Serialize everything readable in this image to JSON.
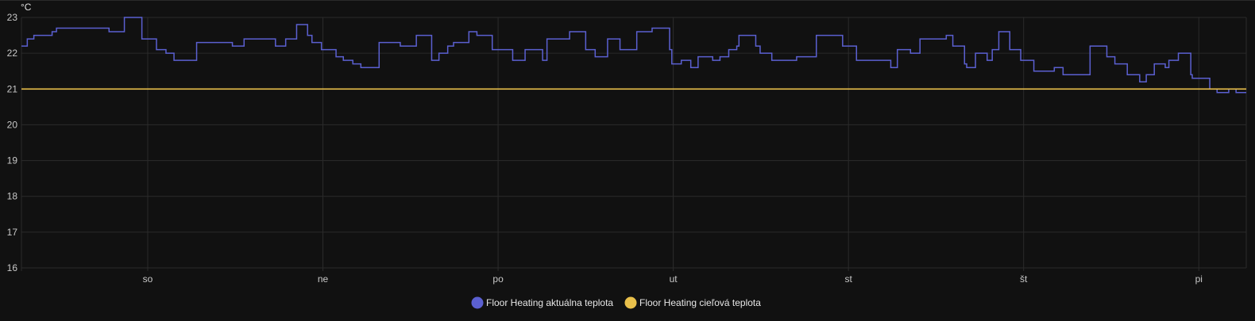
{
  "chart_data": {
    "type": "line",
    "step": true,
    "ylabel": "°C",
    "xlabel": "",
    "x_unit": "hours relative to start of 'so'",
    "xlim": [
      -17.3,
      150.5
    ],
    "ylim": [
      16,
      23
    ],
    "yticks": [
      16,
      17,
      18,
      19,
      20,
      21,
      22,
      23
    ],
    "xticks": [
      {
        "x": 0,
        "label": "so"
      },
      {
        "x": 24,
        "label": "ne"
      },
      {
        "x": 48,
        "label": "po"
      },
      {
        "x": 72,
        "label": "ut"
      },
      {
        "x": 96,
        "label": "st"
      },
      {
        "x": 120,
        "label": "št"
      },
      {
        "x": 144,
        "label": "pi"
      }
    ],
    "grid": true,
    "legend_position": "bottom-center",
    "series": [
      {
        "name": "Floor Heating aktuálna teplota",
        "color": "#5b60d1",
        "points": [
          [
            -17.3,
            22.2
          ],
          [
            -16.5,
            22.4
          ],
          [
            -15.6,
            22.5
          ],
          [
            -13.1,
            22.6
          ],
          [
            -12.5,
            22.7
          ],
          [
            -5.3,
            22.6
          ],
          [
            -3.2,
            23.0
          ],
          [
            -0.8,
            22.4
          ],
          [
            1.2,
            22.1
          ],
          [
            2.5,
            22.0
          ],
          [
            3.6,
            21.8
          ],
          [
            6.7,
            22.3
          ],
          [
            11.6,
            22.2
          ],
          [
            13.2,
            22.4
          ],
          [
            17.5,
            22.2
          ],
          [
            18.9,
            22.4
          ],
          [
            20.4,
            22.8
          ],
          [
            21.9,
            22.5
          ],
          [
            22.5,
            22.3
          ],
          [
            23.8,
            22.1
          ],
          [
            25.8,
            21.9
          ],
          [
            26.8,
            21.8
          ],
          [
            28.1,
            21.7
          ],
          [
            29.2,
            21.6
          ],
          [
            31.7,
            22.3
          ],
          [
            34.6,
            22.2
          ],
          [
            36.8,
            22.5
          ],
          [
            38.9,
            21.8
          ],
          [
            39.9,
            22.0
          ],
          [
            41.1,
            22.2
          ],
          [
            41.9,
            22.3
          ],
          [
            44.0,
            22.6
          ],
          [
            45.1,
            22.5
          ],
          [
            47.2,
            22.1
          ],
          [
            50.0,
            21.8
          ],
          [
            51.7,
            22.1
          ],
          [
            54.1,
            21.8
          ],
          [
            54.7,
            22.4
          ],
          [
            57.8,
            22.6
          ],
          [
            60.0,
            22.1
          ],
          [
            61.3,
            21.9
          ],
          [
            63.0,
            22.4
          ],
          [
            64.7,
            22.1
          ],
          [
            67.0,
            22.6
          ],
          [
            69.1,
            22.7
          ],
          [
            71.5,
            22.1
          ],
          [
            71.8,
            21.7
          ],
          [
            73.1,
            21.8
          ],
          [
            74.4,
            21.6
          ],
          [
            75.4,
            21.9
          ],
          [
            77.4,
            21.8
          ],
          [
            78.4,
            21.9
          ],
          [
            79.6,
            22.1
          ],
          [
            80.7,
            22.2
          ],
          [
            81.0,
            22.5
          ],
          [
            83.3,
            22.2
          ],
          [
            83.9,
            22.0
          ],
          [
            85.5,
            21.8
          ],
          [
            88.9,
            21.9
          ],
          [
            91.6,
            22.5
          ],
          [
            95.2,
            22.2
          ],
          [
            97.1,
            21.8
          ],
          [
            101.8,
            21.6
          ],
          [
            102.7,
            22.1
          ],
          [
            104.5,
            22.0
          ],
          [
            105.8,
            22.4
          ],
          [
            109.4,
            22.5
          ],
          [
            110.3,
            22.2
          ],
          [
            111.9,
            21.7
          ],
          [
            112.2,
            21.6
          ],
          [
            113.4,
            22.0
          ],
          [
            115.0,
            21.8
          ],
          [
            115.7,
            22.1
          ],
          [
            116.6,
            22.6
          ],
          [
            118.1,
            22.1
          ],
          [
            119.6,
            21.8
          ],
          [
            121.4,
            21.5
          ],
          [
            124.2,
            21.6
          ],
          [
            125.4,
            21.4
          ],
          [
            129.1,
            22.2
          ],
          [
            131.4,
            21.9
          ],
          [
            132.5,
            21.7
          ],
          [
            134.2,
            21.4
          ],
          [
            135.9,
            21.2
          ],
          [
            136.8,
            21.4
          ],
          [
            137.9,
            21.7
          ],
          [
            139.4,
            21.6
          ],
          [
            139.9,
            21.8
          ],
          [
            141.2,
            22.0
          ],
          [
            142.9,
            21.4
          ],
          [
            143.1,
            21.3
          ],
          [
            145.5,
            21.0
          ],
          [
            146.5,
            20.9
          ],
          [
            148.1,
            21.0
          ],
          [
            149.1,
            20.9
          ],
          [
            150.5,
            20.9
          ]
        ]
      },
      {
        "name": "Floor Heating cieľová teplota",
        "color": "#e9c04b",
        "points": [
          [
            -17.3,
            21.0
          ],
          [
            150.5,
            21.0
          ]
        ]
      }
    ]
  }
}
